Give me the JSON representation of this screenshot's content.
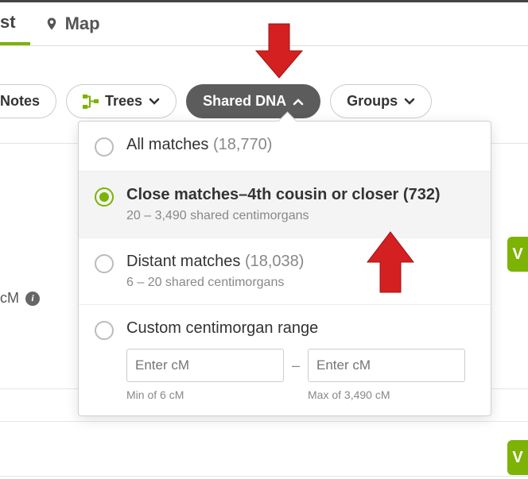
{
  "tabs": {
    "list": "st",
    "map": "Map"
  },
  "filters": {
    "notes": "Notes",
    "trees": "Trees",
    "shared_dna": "Shared DNA",
    "groups": "Groups"
  },
  "dropdown": {
    "all": {
      "label": "All matches",
      "count": "(18,770)"
    },
    "close": {
      "label": "Close matches–4th cousin or closer",
      "count": "(732)",
      "sub": "20 – 3,490 shared centimorgans"
    },
    "distant": {
      "label": "Distant matches",
      "count": "(18,038)",
      "sub": "6 – 20 shared centimorgans"
    },
    "custom": {
      "label": "Custom centimorgan range",
      "placeholder_min": "Enter cM",
      "placeholder_max": "Enter cM",
      "min_hint": "Min of 6 cM",
      "max_hint": "Max of 3,490 cM",
      "dash": "–"
    }
  },
  "side": {
    "cm": "cM",
    "v": "V"
  }
}
